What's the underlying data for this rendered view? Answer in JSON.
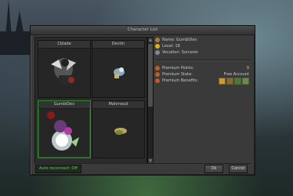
{
  "window": {
    "title": "Character List"
  },
  "characters": [
    {
      "name": "Cblade"
    },
    {
      "name": "Devtin"
    },
    {
      "name": "GumbiDev",
      "selected": true
    },
    {
      "name": "Mahmoud"
    }
  ],
  "details": {
    "name_label": "Name:",
    "name_value": "GumbiDev",
    "level_label": "Level:",
    "level_value": "18",
    "vocation_label": "Vocation:",
    "vocation_value": "Sorcerer",
    "premium_points_label": "Premium Points:",
    "premium_points_value": "0",
    "premium_state_label": "Premium State:",
    "premium_state_value": "Free Account",
    "premium_benefits_label": "Premium Benefits:"
  },
  "footer": {
    "auto_reconnect": "Auto reconnect: Off",
    "ok_label": "Ok",
    "cancel_label": "Cancel"
  },
  "colors": {
    "accent_green": "#2f8a2f",
    "auto_reconnect_text": "#4fd04f",
    "panel": "#3a3a3a"
  }
}
